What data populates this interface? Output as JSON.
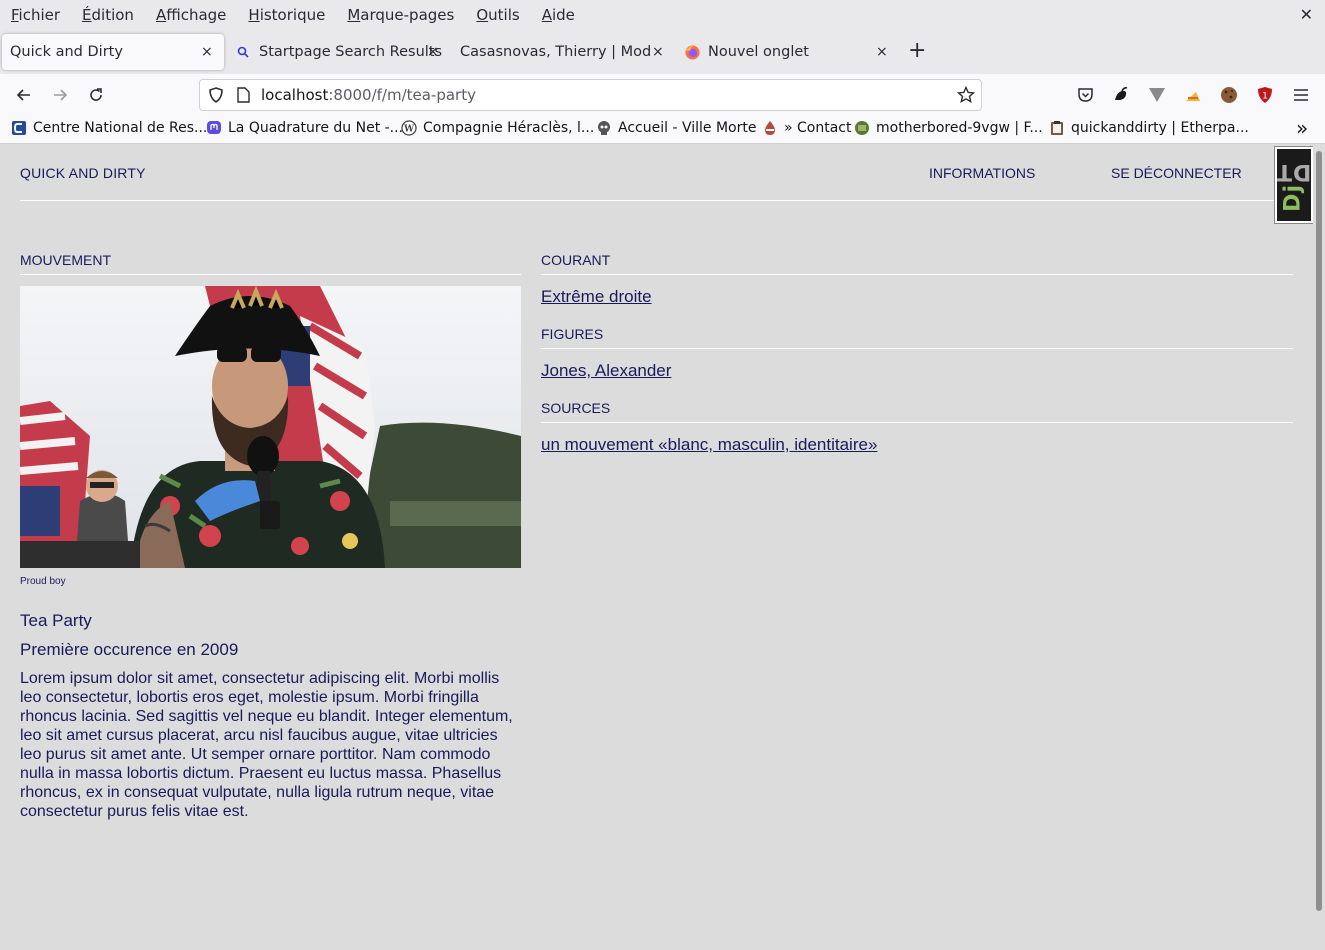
{
  "menu": {
    "items": [
      {
        "pre": "",
        "u": "F",
        "post": "ichier"
      },
      {
        "pre": "",
        "u": "É",
        "post": "dition"
      },
      {
        "pre": "",
        "u": "A",
        "post": "ffichage"
      },
      {
        "pre": "",
        "u": "H",
        "post": "istorique"
      },
      {
        "pre": "",
        "u": "M",
        "post": "arque-pages"
      },
      {
        "pre": "",
        "u": "O",
        "post": "utils"
      },
      {
        "pre": "",
        "u": "A",
        "post": "ide"
      }
    ],
    "close": "✕"
  },
  "tabs": [
    {
      "title": "Quick and Dirty",
      "close": "×"
    },
    {
      "title": "Startpage Search Results",
      "close": "×"
    },
    {
      "title": "Casasnovas, Thierry | Modific",
      "close": "×"
    },
    {
      "title": "Nouvel onglet",
      "close": "×"
    }
  ],
  "newtab": "+",
  "url": {
    "host": "localhost",
    "rest": ":8000/f/m/tea-party"
  },
  "bookmarks": [
    "Centre National de Res...",
    "La Quadrature du Net -...",
    "Compagnie Héraclès, l...",
    "Accueil - Ville Morte",
    "» Contact",
    "motherbored-9vgw | F...",
    "quickanddirty | Etherpa..."
  ],
  "bookmarks_overflow": "»",
  "badge_count": "1",
  "site": {
    "title": "QUICK AND DIRTY",
    "nav": [
      "INFORMATIONS",
      "SE DÉCONNECTER"
    ]
  },
  "main": {
    "left_heading": "MOUVEMENT",
    "caption": "Proud boy",
    "name": "Tea Party",
    "date": "Première occurence en 2009",
    "description": "Lorem ipsum dolor sit amet, consectetur adipiscing elit. Morbi mollis leo consectetur, lobortis eros eget, molestie ipsum. Morbi fringilla rhoncus lacinia. Sed sagittis vel neque eu blandit. Integer elementum, leo sit amet cursus placerat, arcu nisl faucibus augue, vitae ultricies leo purus sit amet ante. Ut semper ornare porttitor. Nam commodo nulla in massa lobortis dictum. Praesent eu luctus massa. Phasellus rhoncus, ex in consequat vulputate, nulla ligula rutrum neque, vitae consectetur purus felis vitae est.",
    "courant_heading": "COURANT",
    "courant_link": "Extrême droite",
    "figures_heading": "FIGURES",
    "figures_link": "Jones, Alexander",
    "sources_heading": "SOURCES",
    "sources_link": "un mouvement «blanc, masculin, identitaire»"
  },
  "djdt": {
    "dj": "Dj",
    "dt": "DT"
  },
  "colors": {
    "page_bg": "#dcdcdc",
    "text": "#1a1a5a",
    "djdt_green": "#8dbe5e"
  }
}
